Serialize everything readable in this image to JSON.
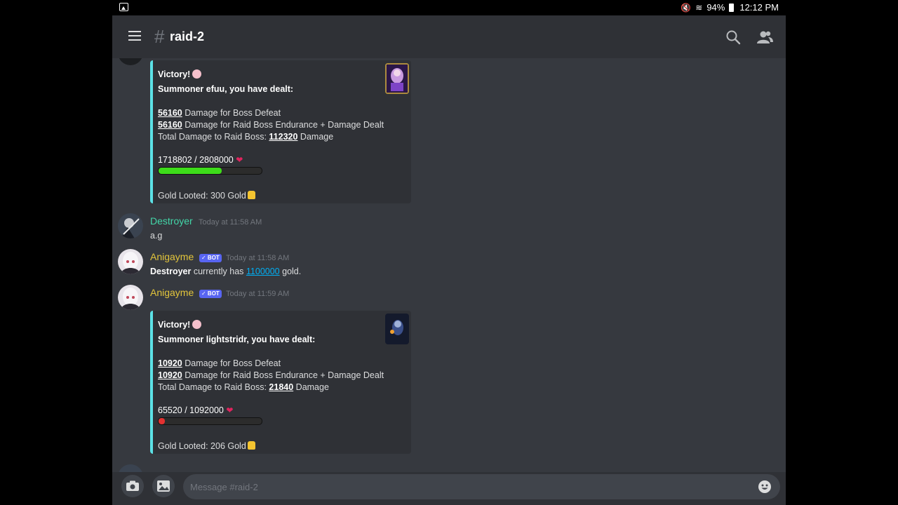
{
  "status_bar": {
    "battery": "94%",
    "time": "12:12 PM"
  },
  "header": {
    "hash": "#",
    "channel": "raid-2"
  },
  "messages": [
    {
      "embed": {
        "title": "Victory!",
        "summoner_line": "Summoner efuu, you have dealt:",
        "boss_defeat_value": "56160",
        "boss_defeat_label": " Damage for Boss Defeat",
        "endurance_value": "56160",
        "endurance_label": " Damage for Raid Boss Endurance + Damage Dealt",
        "total_prefix": "Total Damage to Raid Boss: ",
        "total_value": "112320",
        "total_suffix": " Damage",
        "hp_text": "1718802 / 2808000",
        "hp_fraction": 0.612,
        "hp_color": "#3ddc1a",
        "gold_text": "Gold Looted: 300 Gold"
      }
    },
    {
      "username": "Destroyer",
      "username_color": "#43d6a8",
      "timestamp": "Today at 11:58 AM",
      "text": "a.g"
    },
    {
      "username": "Anigayme",
      "username_color": "#e3c53b",
      "bot_tag": "✓ BOT",
      "timestamp": "Today at 11:58 AM",
      "text_bold": "Destroyer",
      "text_mid": " currently has ",
      "text_link": "1100000",
      "text_end": " gold."
    },
    {
      "username": "Anigayme",
      "username_color": "#e3c53b",
      "bot_tag": "✓ BOT",
      "timestamp": "Today at 11:59 AM",
      "embed": {
        "title": "Victory!",
        "summoner_line": "Summoner lightstridr, you have dealt:",
        "boss_defeat_value": "10920",
        "boss_defeat_label": " Damage for Boss Defeat",
        "endurance_value": "10920",
        "endurance_label": " Damage for Raid Boss Endurance + Damage Dealt",
        "total_prefix": "Total Damage to Raid Boss: ",
        "total_value": "21840",
        "total_suffix": " Damage",
        "hp_text": "65520 / 1092000",
        "hp_fraction": 0.06,
        "hp_color": "#e33131",
        "gold_text": "Gold Looted: 206 Gold"
      }
    }
  ],
  "composer": {
    "placeholder": "Message #raid-2"
  },
  "icons": {
    "menu": "hamburger-icon",
    "search": "search-icon",
    "members": "members-icon",
    "camera": "camera-icon",
    "image": "image-icon",
    "emoji": "emoji-icon",
    "jump": "chevron-down-icon"
  }
}
